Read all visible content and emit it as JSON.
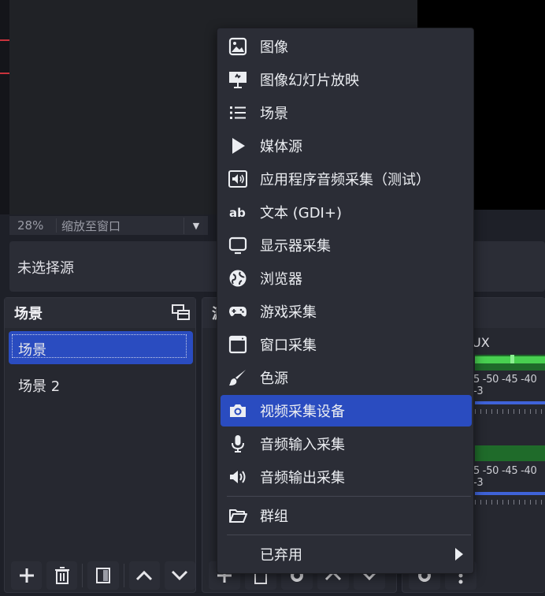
{
  "preview": {
    "zoom": "28%",
    "fit_label": "缩放至窗口"
  },
  "source_bar": {
    "no_source_label": "未选择源"
  },
  "scenes_dock": {
    "title": "场景",
    "items": [
      {
        "label": "场景"
      },
      {
        "label": "场景 2"
      }
    ]
  },
  "sources_dock": {
    "title_fragment": "源"
  },
  "mixer_dock": {
    "track_label_fragment": "UX",
    "scale_text": "5 -50 -45 -40 -3"
  },
  "context_menu": {
    "items": [
      {
        "label": "图像",
        "icon": "image-icon"
      },
      {
        "label": "图像幻灯片放映",
        "icon": "slideshow-icon"
      },
      {
        "label": "场景",
        "icon": "list-icon"
      },
      {
        "label": "媒体源",
        "icon": "play-icon"
      },
      {
        "label": "应用程序音频采集（测试）",
        "icon": "app-audio-icon"
      },
      {
        "label": "文本 (GDI+)",
        "icon": "text-icon"
      },
      {
        "label": "显示器采集",
        "icon": "monitor-icon"
      },
      {
        "label": "浏览器",
        "icon": "globe-icon"
      },
      {
        "label": "游戏采集",
        "icon": "gamepad-icon"
      },
      {
        "label": "窗口采集",
        "icon": "window-icon"
      },
      {
        "label": "色源",
        "icon": "brush-icon"
      },
      {
        "label": "视频采集设备",
        "icon": "camera-icon"
      },
      {
        "label": "音频输入采集",
        "icon": "microphone-icon"
      },
      {
        "label": "音频输出采集",
        "icon": "speaker-icon"
      },
      {
        "label": "群组",
        "icon": "folder-icon"
      },
      {
        "label": "已弃用",
        "icon": "chevron-right-icon"
      }
    ],
    "active_index": 11
  },
  "colors": {
    "accent": "#2a4cc0",
    "meter_green": "#48d050",
    "background": "#1e2028"
  }
}
